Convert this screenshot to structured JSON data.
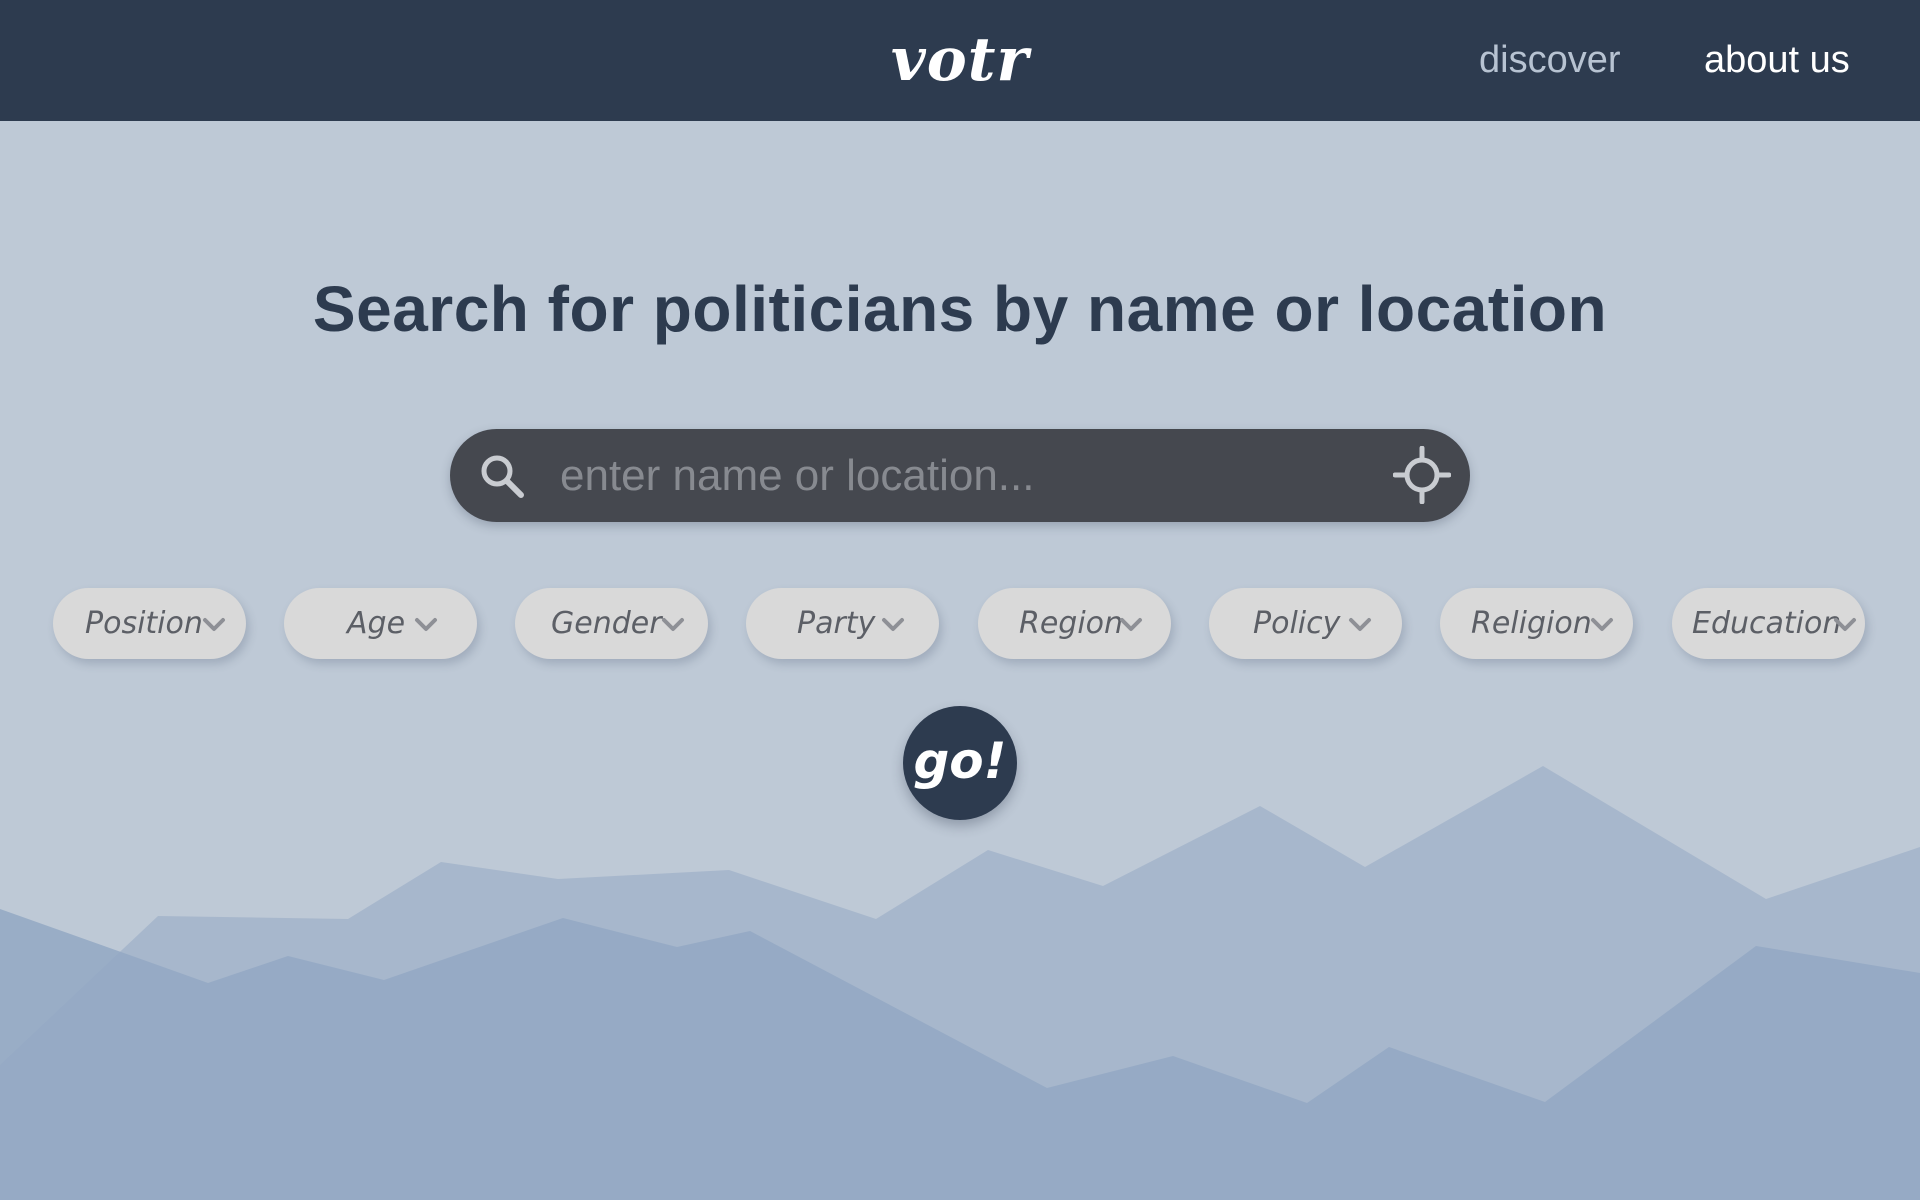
{
  "header": {
    "logo_text": "votr",
    "nav": {
      "discover": "discover",
      "about_us": "about us"
    }
  },
  "main": {
    "headline": "Search for politicians by name or location",
    "search": {
      "placeholder": "enter name or location...",
      "value": ""
    },
    "filters": [
      {
        "label": "Position"
      },
      {
        "label": "Age"
      },
      {
        "label": "Gender"
      },
      {
        "label": "Party"
      },
      {
        "label": "Region"
      },
      {
        "label": "Policy"
      },
      {
        "label": "Religion"
      },
      {
        "label": "Education"
      }
    ],
    "go_label": "go!"
  },
  "icons": {
    "search": "search-icon",
    "locate": "crosshair-locate-icon",
    "dropdown": "chevron-down-icon"
  },
  "colors": {
    "header_bg": "#2d3b4f",
    "page_bg": "#bec9d6",
    "search_bg": "#45484f",
    "pill_bg": "#d9d9d9",
    "mountain_back": "#a3b4ca",
    "mountain_front": "#93a8c3"
  }
}
